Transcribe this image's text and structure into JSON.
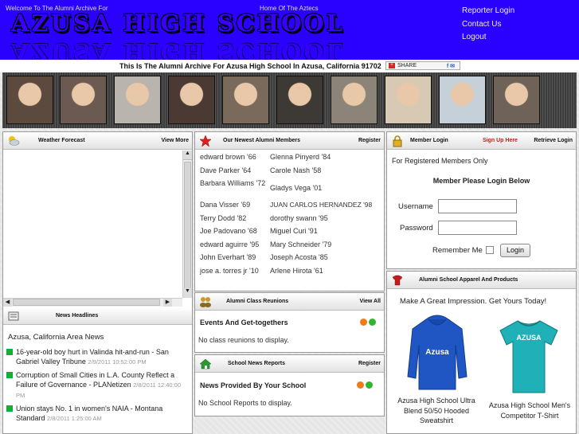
{
  "header": {
    "welcome": "Welcome To The Alumni Archive For",
    "home_of": "Home Of The Aztecs",
    "school_name": "AZUSA HIGH SCHOOL",
    "links": [
      "Reporter Login",
      "Contact Us",
      "Logout"
    ]
  },
  "subtitle": "This Is The Alumni Archive For Azusa High School In Azusa, California 91702",
  "share_label": "SHARE",
  "photo_colors": [
    "#5c4a3e",
    "#6b5a52",
    "#b9b4ad",
    "#4b3a33",
    "#7a6a5b",
    "#3d3a35",
    "#8d8479",
    "#d8c9b4",
    "#c5d0d8",
    "#6e6259"
  ],
  "weather": {
    "title": "Weather Forecast",
    "link": "View More"
  },
  "news": {
    "title": "News Headlines",
    "area": "Azusa, California Area News",
    "items": [
      {
        "text": "16-year-old boy hurt in Valinda hit-and-run - San Gabriel Valley Tribune",
        "date": "2/9/2011 10:52:00 PM"
      },
      {
        "text": "Corruption of Small Cities in L.A. County Reflect a Failure of Governance - PLANetizen",
        "date": "2/8/2011 12:40:00 PM"
      },
      {
        "text": "Union stays No. 1 in women's NAIA - Montana Standard",
        "date": "2/8/2011 1:25:00 AM"
      }
    ]
  },
  "alumni": {
    "title": "Our Newest Alumni Members",
    "link": "Register",
    "members": [
      "edward brown '66",
      "Glenna Pinyerd '84",
      "Dave Parker '64",
      "Carole Nash '58",
      "Barbara Williams '72",
      "Gladys Vega '01",
      "Dana Visser '69",
      "JUAN CARLOS HERNANDEZ '98",
      "Terry Dodd '82",
      "dorothy swann '95",
      "Joe Padovano '68",
      "Miguel Curi '91",
      "edward aguirre '95",
      "Mary Schneider '79",
      "John Everhart '89",
      "Joseph Acosta '85",
      "jose a. torres jr '10",
      "Arlene Hirota '61"
    ]
  },
  "reunions": {
    "title": "Alumni Class Reunions",
    "link": "View All",
    "sub": "Events And Get-togethers",
    "empty": "No class reunions to display."
  },
  "school_news": {
    "title": "School News Reports",
    "link": "Register",
    "sub": "News Provided By Your School",
    "empty": "No School Reports to display."
  },
  "login": {
    "title": "Member Login",
    "signup": "Sign Up Here",
    "retrieve": "Retrieve Login",
    "note": "For Registered Members Only",
    "prompt": "Member Please Login Below",
    "username_label": "Username",
    "password_label": "Password",
    "remember_label": "Remember Me",
    "button": "Login"
  },
  "apparel": {
    "title": "Alumni School Apparel And Products",
    "tagline": "Make A Great Impression. Get Yours Today!",
    "products": [
      {
        "name": "Azusa High School Ultra Blend 50/50 Hooded Sweatshirt",
        "print": "Azusa"
      },
      {
        "name": "Azusa High School Men's Competitor T-Shirt",
        "print": "AZUSA"
      }
    ]
  },
  "colors": {
    "header_blue": "#2a00ff",
    "signup_red": "#d11919",
    "bullet_green": "#1db11d"
  }
}
